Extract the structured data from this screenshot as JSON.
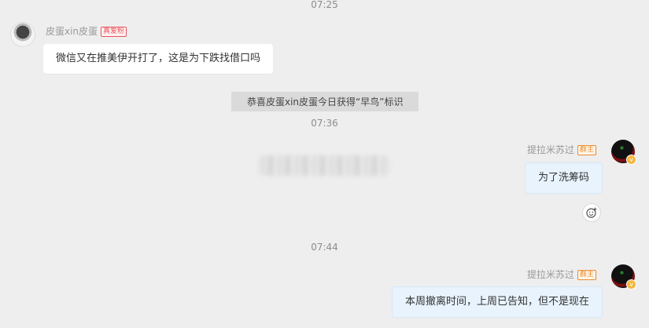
{
  "timestamps": [
    "07:25",
    "07:36",
    "07:44"
  ],
  "messages": [
    {
      "sender": "皮蛋xin皮蛋",
      "badge": "真爱粉",
      "text": "微信又在推美伊开打了，这是为下跌找借口吗"
    },
    {
      "sender": "提拉米苏过",
      "badge": "群主",
      "text": "为了洗筹码"
    },
    {
      "sender": "提拉米苏过",
      "badge": "群主",
      "text": "本周撤离时间，上周已告知，但不是现在"
    }
  ],
  "system_notice": "恭喜皮蛋xin皮蛋今日获得“早鸟”标识",
  "icons": {
    "emoji_reaction": "smile-add-icon",
    "verified": "verified-v-icon"
  },
  "colors": {
    "background": "#eeeeee",
    "bubble_self": "#e8f3fd",
    "bubble_other": "#ffffff",
    "badge_fan": "#e8545d",
    "badge_owner": "#e88c2c"
  }
}
